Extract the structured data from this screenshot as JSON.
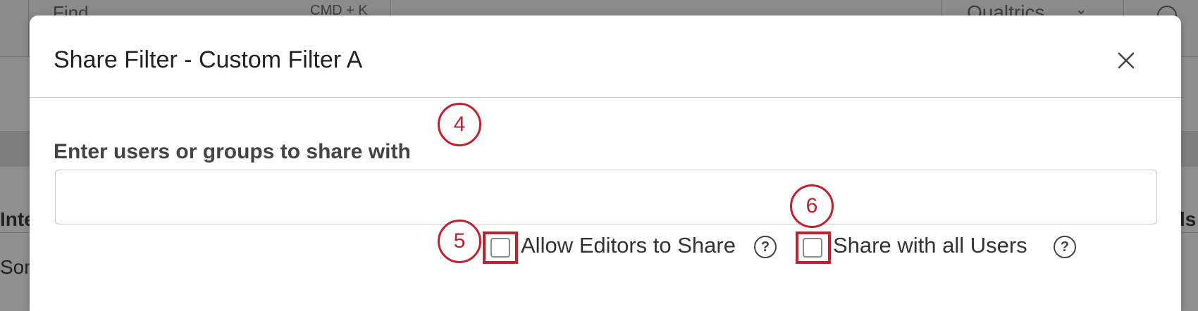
{
  "background": {
    "find_label": "Find",
    "find_shortcut": "CMD + K",
    "brand_label": "Qualtrics",
    "column_left_partial": "Inte",
    "column_right_partial": "ls",
    "cell_left_partial": "Som"
  },
  "dialog": {
    "title": "Share Filter - Custom Filter A",
    "close_icon": "close-icon",
    "share_label": "Enter users or groups to share with",
    "share_input_value": "",
    "share_input_placeholder": "",
    "allow_editors_label": "Allow Editors to Share",
    "allow_editors_checked": false,
    "share_all_label": "Share with all Users",
    "share_all_checked": false,
    "help_glyph": "?"
  },
  "annotations": {
    "step_4": "4",
    "step_5": "5",
    "step_6": "6",
    "accent_color": "#c2202f"
  }
}
